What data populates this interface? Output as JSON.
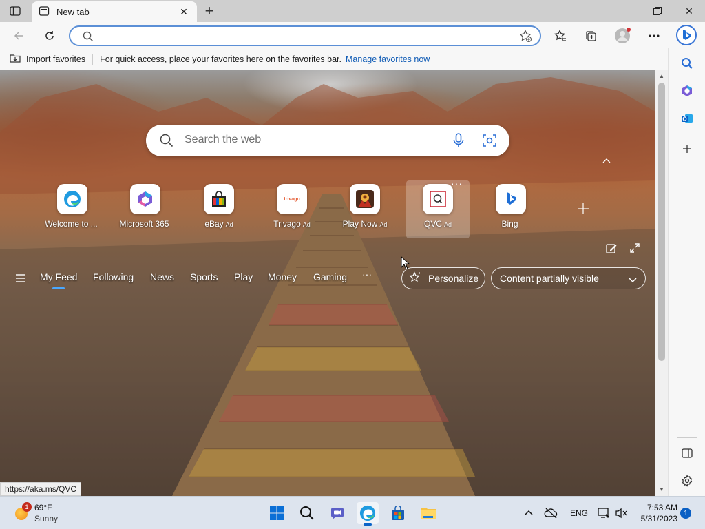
{
  "tabs": [
    {
      "title": "New tab"
    }
  ],
  "address_bar": {
    "value": "",
    "placeholder": ""
  },
  "favorites_bar": {
    "import_label": "Import favorites",
    "message": "For quick access, place your favorites here on the favorites bar.",
    "link": "Manage favorites now"
  },
  "search": {
    "placeholder": "Search the web"
  },
  "quick_links": [
    {
      "label": "Welcome to ...",
      "ad": ""
    },
    {
      "label": "Microsoft 365",
      "ad": ""
    },
    {
      "label": "eBay",
      "ad": "Ad"
    },
    {
      "label": "Trivago",
      "ad": "Ad",
      "icon_text": "trivago"
    },
    {
      "label": "Play Now",
      "ad": "Ad"
    },
    {
      "label": "QVC",
      "ad": "Ad"
    },
    {
      "label": "Bing",
      "ad": ""
    }
  ],
  "feed_nav": {
    "items": [
      "My Feed",
      "Following",
      "News",
      "Sports",
      "Play",
      "Money",
      "Gaming"
    ],
    "more": "···",
    "active": "My Feed"
  },
  "personalize_label": "Personalize",
  "content_visibility": "Content partially visible",
  "status_url": "https://aka.ms/QVC",
  "taskbar": {
    "weather": {
      "temp": "69°F",
      "condition": "Sunny",
      "badge": "1"
    },
    "language": "ENG",
    "time": "7:53 AM",
    "date": "5/31/2023",
    "notifications": "1"
  },
  "colors": {
    "accent": "#0f5bb5",
    "address_border": "#5b8fd6",
    "taskbar": "#dde4ee"
  }
}
